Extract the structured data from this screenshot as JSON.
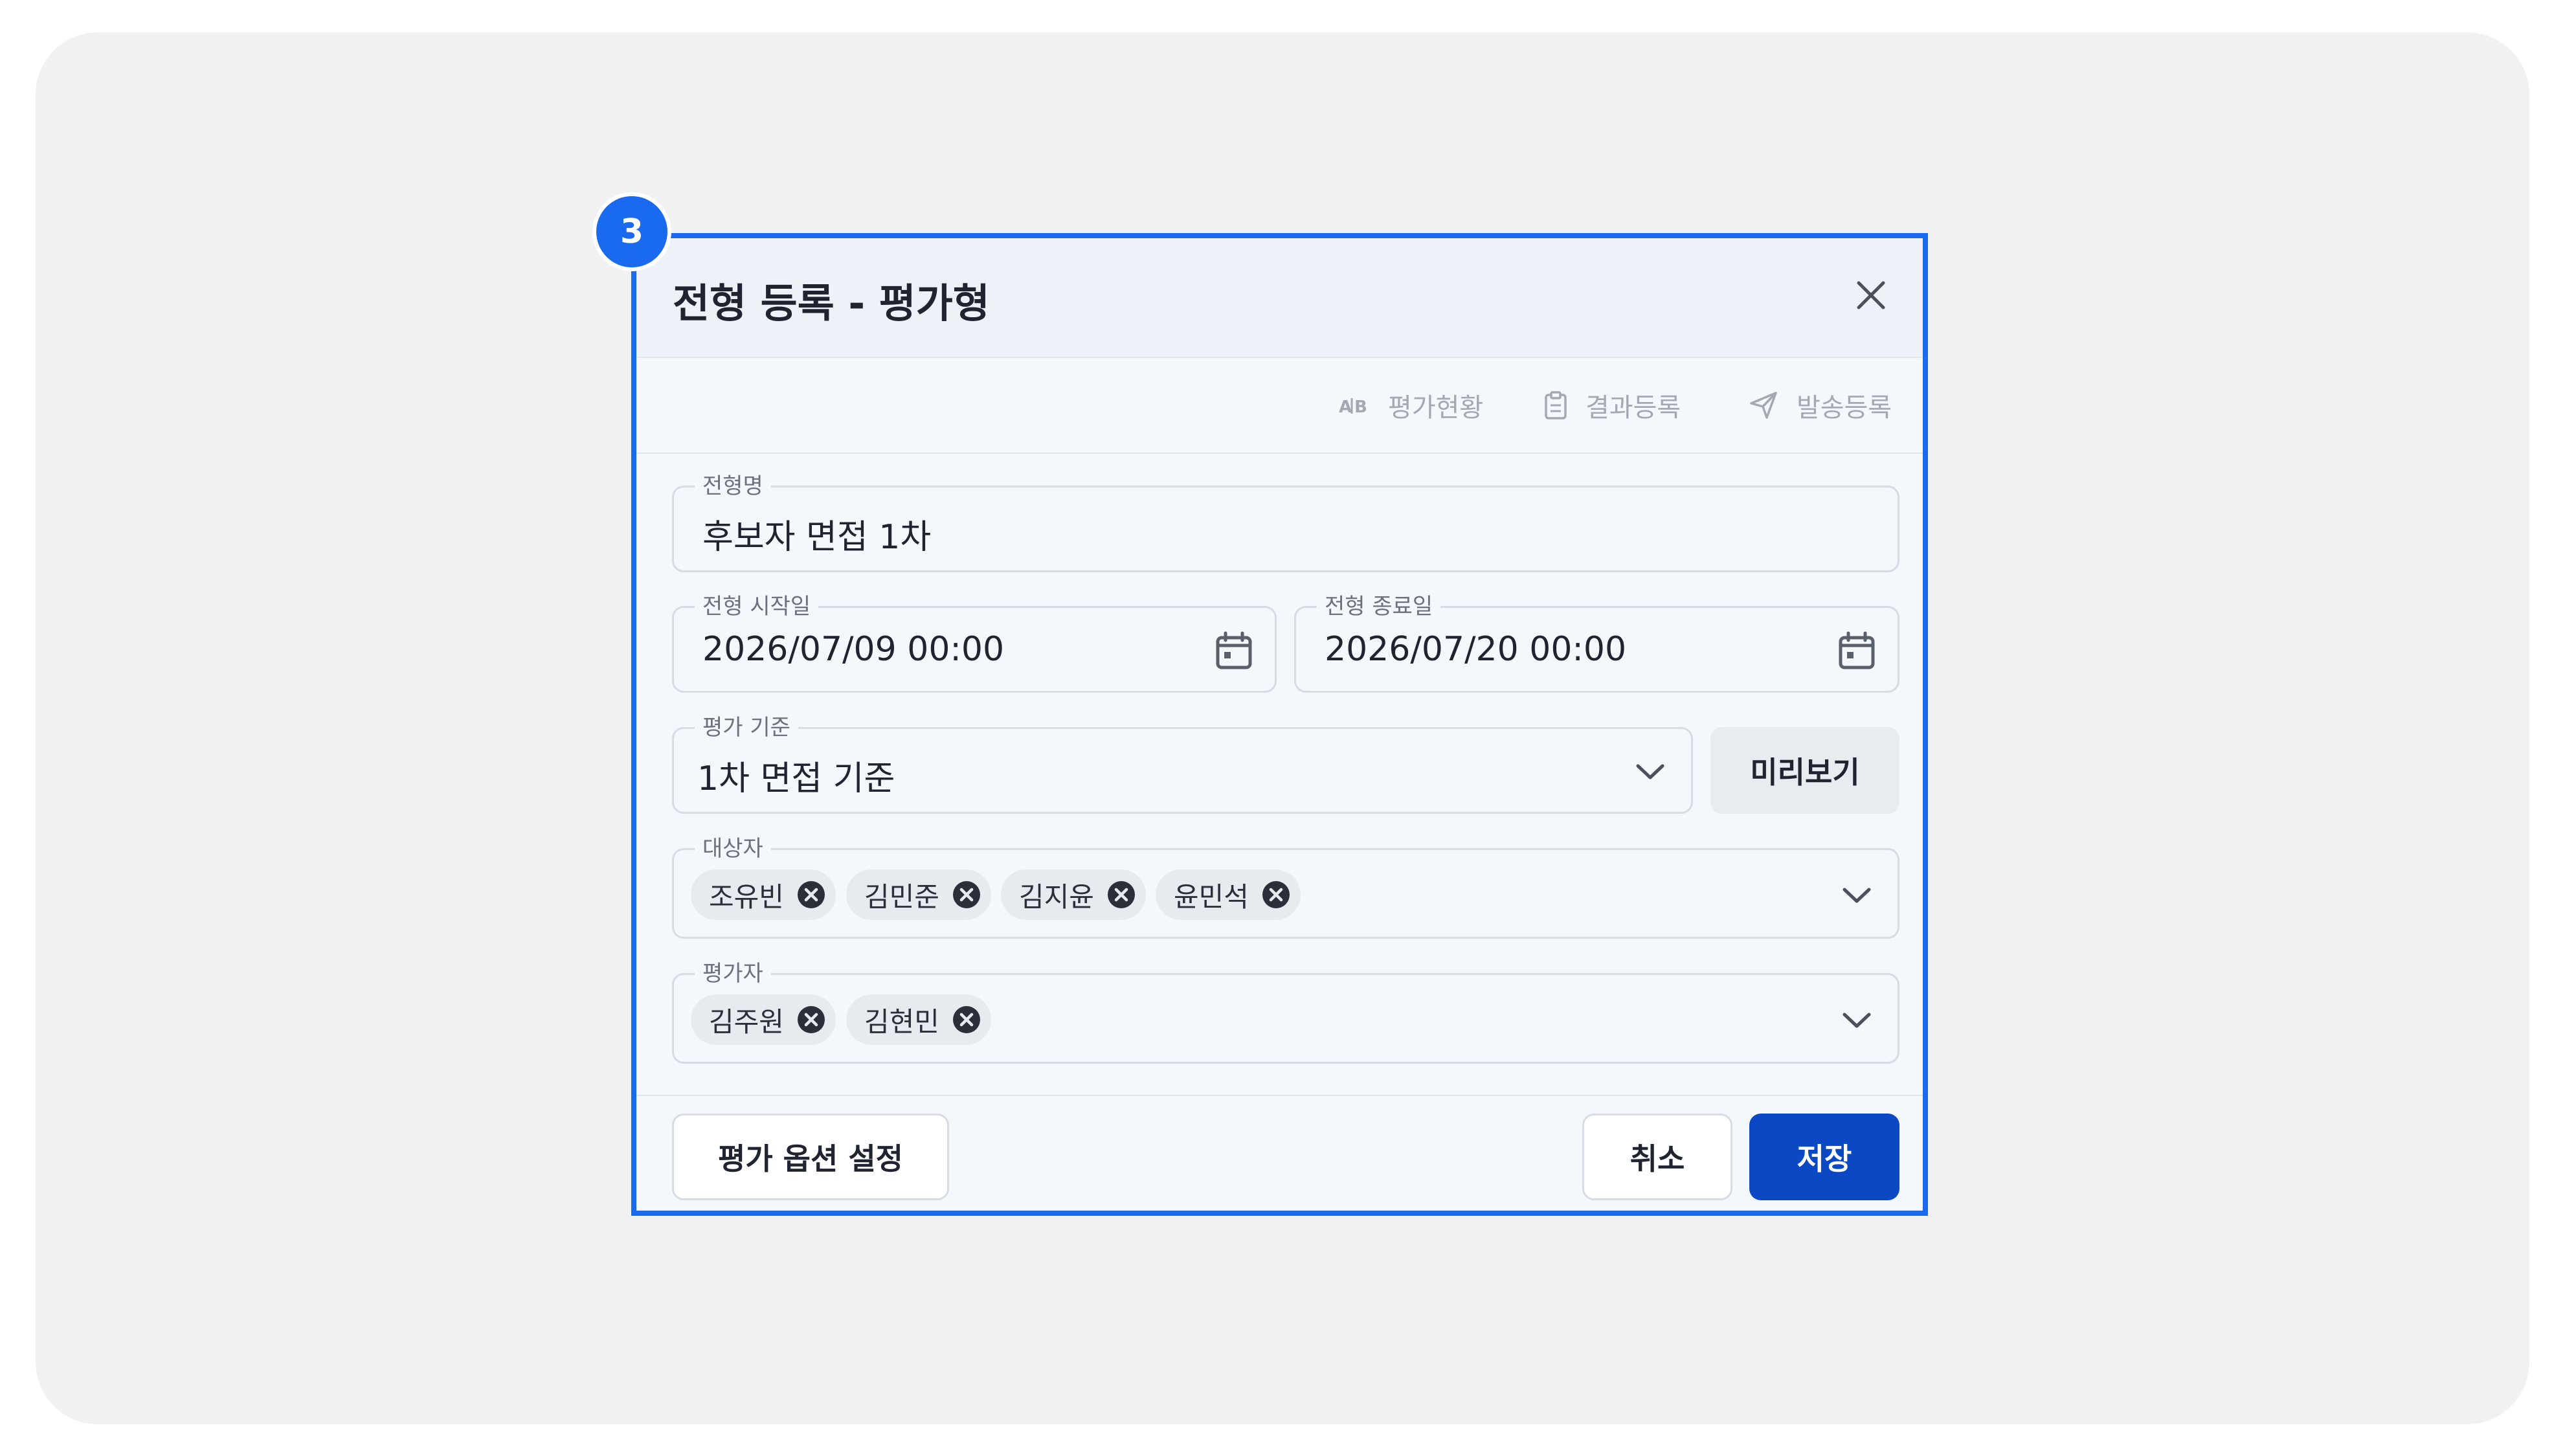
{
  "step_badge": "3",
  "dialog": {
    "title": "전형 등록 - 평가형"
  },
  "toolbar": {
    "items": [
      {
        "label": "평가현황",
        "icon": "ab-icon"
      },
      {
        "label": "결과등록",
        "icon": "clipboard-icon"
      },
      {
        "label": "발송등록",
        "icon": "send-icon"
      }
    ]
  },
  "form": {
    "name": {
      "label": "전형명",
      "value": "후보자 면접 1차"
    },
    "start_date": {
      "label": "전형 시작일",
      "value": "2026/07/09 00:00"
    },
    "end_date": {
      "label": "전형 종료일",
      "value": "2026/07/20 00:00"
    },
    "criteria": {
      "label": "평가 기준",
      "value": "1차 면접 기준",
      "preview_label": "미리보기"
    },
    "targets": {
      "label": "대상자",
      "chips": [
        "조유빈",
        "김민준",
        "김지윤",
        "윤민석"
      ]
    },
    "evaluators": {
      "label": "평가자",
      "chips": [
        "김주원",
        "김현민"
      ]
    }
  },
  "footer": {
    "options_label": "평가 옵션 설정",
    "cancel_label": "취소",
    "save_label": "저장"
  },
  "colors": {
    "accent": "#1a6af0",
    "primary_button": "#0a48c4",
    "chip_bg": "#e7eaef"
  }
}
